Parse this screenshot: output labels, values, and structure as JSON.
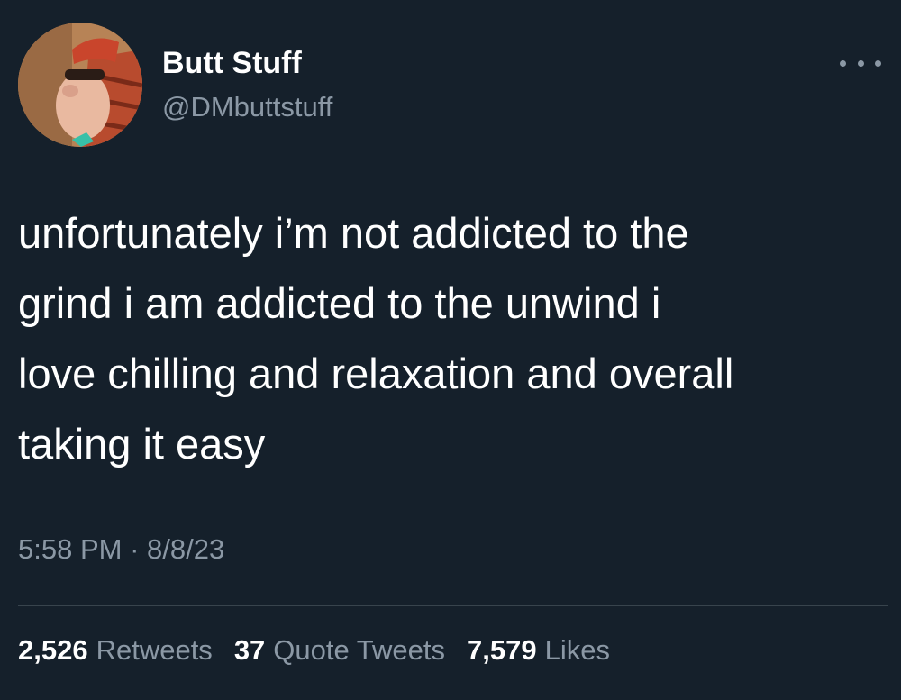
{
  "author": {
    "display_name": "Butt Stuff",
    "handle": "@DMbuttstuff",
    "avatar_icon": "cartoon-avatar"
  },
  "menu_icon": "more-dots-icon",
  "tweet": {
    "text": "unfortunately i’m not addicted to the\ngrind i am addicted to the unwind i\nlove chilling and relaxation and overall\ntaking it easy",
    "time": "5:58 PM",
    "separator": "·",
    "date": "8/8/23"
  },
  "stats": {
    "retweets_count": "2,526",
    "retweets_label": "Retweets",
    "quotes_count": "37",
    "quotes_label": "Quote Tweets",
    "likes_count": "7,579",
    "likes_label": "Likes"
  },
  "colors": {
    "background": "#15202b",
    "primary_text": "#ffffff",
    "secondary_text": "#8b98a5",
    "divider": "#38444d"
  }
}
